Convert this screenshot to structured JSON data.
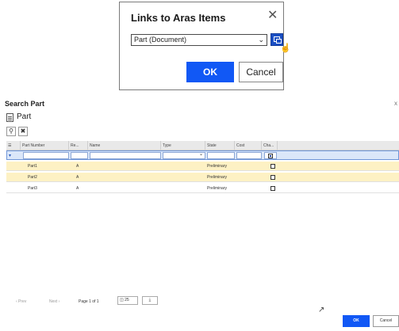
{
  "links_dialog": {
    "title": "Links to Aras Items",
    "close_glyph": "✕",
    "selected_type": "Part (Document)",
    "ok_label": "OK",
    "cancel_label": "Cancel"
  },
  "search_dialog": {
    "title": "Search Part",
    "close_glyph": "x",
    "item_type_name": "Part",
    "toolbar": {
      "search_glyph": "🔍",
      "clear_glyph": "✖"
    },
    "columns": [
      "Part Number",
      "Re...",
      "Name",
      "Type",
      "State",
      "Cost",
      "Cha..."
    ],
    "rows": [
      {
        "part_number": "Part1",
        "revision": "A",
        "name": "",
        "type": "",
        "state": "Preliminary",
        "cost": "",
        "checked": false
      },
      {
        "part_number": "Part2",
        "revision": "A",
        "name": "",
        "type": "",
        "state": "Preliminary",
        "cost": "",
        "checked": false
      },
      {
        "part_number": "Part3",
        "revision": "A",
        "name": "",
        "type": "",
        "state": "Preliminary",
        "cost": "",
        "checked": false
      }
    ],
    "pager": {
      "prev": "‹ Prev",
      "next": "Next ›",
      "page_info": "Page 1 of 1",
      "page_size": "25"
    },
    "ok_label": "OK",
    "cancel_label": "Cancel"
  },
  "colors": {
    "accent": "#1158f5",
    "highlight_row": "#fdf1c4",
    "filter_row": "#dbe7f9"
  }
}
